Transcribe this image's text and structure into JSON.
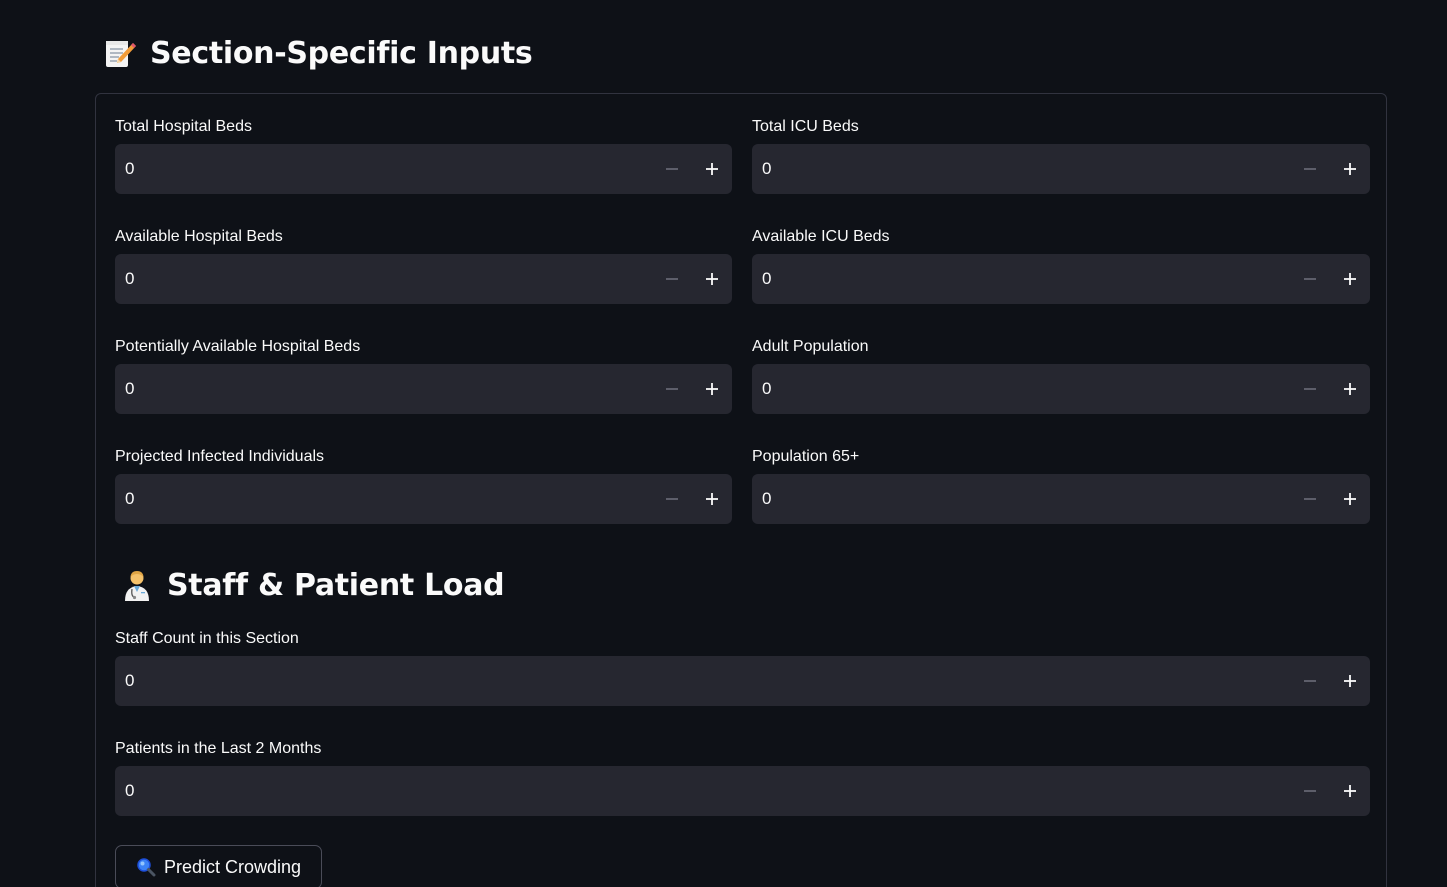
{
  "section": {
    "title": "Section-Specific Inputs",
    "icon": "memo-pencil-icon"
  },
  "fields": [
    {
      "label": "Total Hospital Beds",
      "value": "0"
    },
    {
      "label": "Total ICU Beds",
      "value": "0"
    },
    {
      "label": "Available Hospital Beds",
      "value": "0"
    },
    {
      "label": "Available ICU Beds",
      "value": "0"
    },
    {
      "label": "Potentially Available Hospital Beds",
      "value": "0"
    },
    {
      "label": "Adult Population",
      "value": "0"
    },
    {
      "label": "Projected Infected Individuals",
      "value": "0"
    },
    {
      "label": "Population 65+",
      "value": "0"
    }
  ],
  "staff": {
    "title": "Staff & Patient Load",
    "icon": "health-worker-icon",
    "fields": [
      {
        "label": "Staff Count in this Section",
        "value": "0"
      },
      {
        "label": "Patients in the Last 2 Months",
        "value": "0"
      }
    ]
  },
  "predict": {
    "label": "Predict Crowding",
    "icon": "magnifying-glass-icon"
  },
  "colors": {
    "background": "#0e1117",
    "input_bg": "#262730",
    "border": "#31333f",
    "text": "#fafafa",
    "minus_disabled": "#6b6d78"
  }
}
